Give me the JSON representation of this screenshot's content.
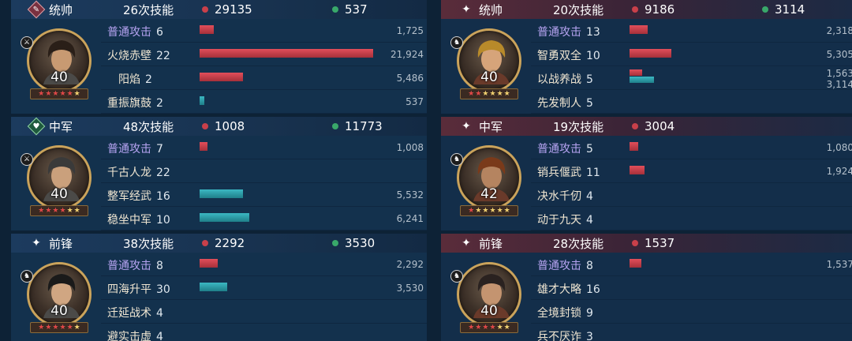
{
  "left": [
    {
      "role": "统帅",
      "role_icon": "diamond-red-feather-icon",
      "skills": "26次技能",
      "damage": "29135",
      "heal": "537",
      "level": "40",
      "stars": [
        "red",
        "red",
        "red",
        "red",
        "red",
        "gold"
      ],
      "badge": "sword-icon",
      "rows": [
        {
          "name": "普通攻击",
          "count": "6",
          "basic": true,
          "bars": [
            {
              "color": "red",
              "pct": 0.08
            }
          ],
          "values": [
            "1,725"
          ]
        },
        {
          "name": "火烧赤壁",
          "count": "22",
          "basic": false,
          "bars": [
            {
              "color": "red",
              "pct": 1.0
            }
          ],
          "values": [
            "21,924"
          ]
        },
        {
          "name": "阳焰",
          "count": "2",
          "basic": false,
          "indent": true,
          "bars": [
            {
              "color": "red",
              "pct": 0.25
            }
          ],
          "values": [
            "5,486"
          ]
        },
        {
          "name": "重振旗鼓",
          "count": "2",
          "basic": false,
          "bars": [
            {
              "color": "teal",
              "pct": 0.025
            }
          ],
          "values": [
            "537"
          ]
        }
      ]
    },
    {
      "role": "中军",
      "role_icon": "diamond-green-heart-icon",
      "skills": "48次技能",
      "damage": "1008",
      "heal": "11773",
      "level": "40",
      "stars": [
        "red",
        "red",
        "red",
        "red",
        "gold",
        "gold"
      ],
      "badge": "sword-icon",
      "rows": [
        {
          "name": "普通攻击",
          "count": "7",
          "basic": true,
          "bars": [
            {
              "color": "red",
              "pct": 0.046
            }
          ],
          "values": [
            "1,008"
          ]
        },
        {
          "name": "千古人龙",
          "count": "22",
          "basic": false,
          "bars": [],
          "values": []
        },
        {
          "name": "整军经武",
          "count": "16",
          "basic": false,
          "bars": [
            {
              "color": "teal",
              "pct": 0.252
            }
          ],
          "values": [
            "5,532"
          ]
        },
        {
          "name": "稳坐中军",
          "count": "10",
          "basic": false,
          "bars": [
            {
              "color": "teal",
              "pct": 0.285
            }
          ],
          "values": [
            "6,241"
          ]
        }
      ]
    },
    {
      "role": "前锋",
      "role_icon": "sparkle-icon",
      "skills": "38次技能",
      "damage": "2292",
      "heal": "3530",
      "level": "40",
      "stars": [
        "red",
        "red",
        "red",
        "red",
        "red",
        "gold"
      ],
      "badge": "horse-icon",
      "rows": [
        {
          "name": "普通攻击",
          "count": "8",
          "basic": true,
          "bars": [
            {
              "color": "red",
              "pct": 0.105
            }
          ],
          "values": [
            "2,292"
          ]
        },
        {
          "name": "四海升平",
          "count": "30",
          "basic": false,
          "bars": [
            {
              "color": "teal",
              "pct": 0.161
            }
          ],
          "values": [
            "3,530"
          ]
        },
        {
          "name": "迁延战术",
          "count": "4",
          "basic": false,
          "bars": [],
          "values": []
        },
        {
          "name": "避实击虚",
          "count": "4",
          "basic": false,
          "bars": [],
          "values": []
        }
      ]
    }
  ],
  "right": [
    {
      "role": "统帅",
      "role_icon": "sparkle-icon",
      "skills": "20次技能",
      "damage": "9186",
      "heal": "3114",
      "level": "40",
      "stars": [
        "red",
        "red",
        "gold",
        "gold",
        "gold",
        "gold"
      ],
      "badge": "horse-icon",
      "rows": [
        {
          "name": "普通攻击",
          "count": "13",
          "basic": true,
          "bars": [
            {
              "color": "red",
              "pct": 0.106
            }
          ],
          "values": [
            "2,318"
          ]
        },
        {
          "name": "智勇双全",
          "count": "10",
          "basic": false,
          "bars": [
            {
              "color": "red",
              "pct": 0.242
            }
          ],
          "values": [
            "5,305"
          ]
        },
        {
          "name": "以战养战",
          "count": "5",
          "basic": false,
          "bars": [
            {
              "color": "red",
              "pct": 0.071
            },
            {
              "color": "teal",
              "pct": 0.142
            }
          ],
          "values": [
            "1,563",
            "3,114"
          ]
        },
        {
          "name": "先发制人",
          "count": "5",
          "basic": false,
          "bars": [],
          "values": []
        }
      ]
    },
    {
      "role": "中军",
      "role_icon": "sparkle-icon",
      "skills": "19次技能",
      "damage": "3004",
      "heal": "",
      "level": "42",
      "stars": [
        "red",
        "gold",
        "gold",
        "gold",
        "gold",
        "gold"
      ],
      "badge": "horse-icon",
      "rows": [
        {
          "name": "普通攻击",
          "count": "5",
          "basic": true,
          "bars": [
            {
              "color": "red",
              "pct": 0.049
            }
          ],
          "values": [
            "1,080"
          ]
        },
        {
          "name": "销兵偃武",
          "count": "11",
          "basic": false,
          "bars": [
            {
              "color": "red",
              "pct": 0.088
            }
          ],
          "values": [
            "1,924"
          ]
        },
        {
          "name": "决水千仞",
          "count": "4",
          "basic": false,
          "bars": [],
          "values": []
        },
        {
          "name": "动于九天",
          "count": "4",
          "basic": false,
          "bars": [],
          "values": []
        }
      ]
    },
    {
      "role": "前锋",
      "role_icon": "sparkle-icon",
      "skills": "28次技能",
      "damage": "1537",
      "heal": "",
      "level": "40",
      "stars": [
        "red",
        "red",
        "red",
        "red",
        "gold",
        "gold"
      ],
      "badge": "horse-icon",
      "rows": [
        {
          "name": "普通攻击",
          "count": "8",
          "basic": true,
          "bars": [
            {
              "color": "red",
              "pct": 0.07
            }
          ],
          "values": [
            "1,537"
          ]
        },
        {
          "name": "雄才大略",
          "count": "16",
          "basic": false,
          "bars": [],
          "values": []
        },
        {
          "name": "全境封锁",
          "count": "9",
          "basic": false,
          "bars": [],
          "values": []
        },
        {
          "name": "兵不厌诈",
          "count": "3",
          "basic": false,
          "bars": [],
          "values": []
        }
      ]
    }
  ]
}
